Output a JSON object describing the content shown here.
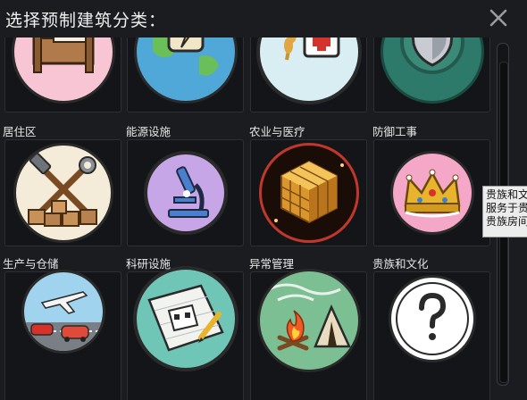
{
  "header": {
    "title": "选择预制建筑分类："
  },
  "categories": [
    {
      "label": "居住区",
      "icon": "bed-icon"
    },
    {
      "label": "能源设施",
      "icon": "energy-globe-icon"
    },
    {
      "label": "农业与医疗",
      "icon": "wheat-medkit-icon"
    },
    {
      "label": "防御工事",
      "icon": "shield-icon"
    },
    {
      "label": "生产与仓储",
      "icon": "tools-crates-icon"
    },
    {
      "label": "科研设施",
      "icon": "microscope-icon"
    },
    {
      "label": "异常管理",
      "icon": "golden-cube-icon"
    },
    {
      "label": "贵族和文化",
      "icon": "crown-icon"
    },
    {
      "label": "",
      "icon": "airplane-cars-icon"
    },
    {
      "label": "",
      "icon": "blueprint-icon"
    },
    {
      "label": "",
      "icon": "campfire-tent-icon"
    },
    {
      "label": "",
      "icon": "question-mark-icon"
    }
  ],
  "tooltip": {
    "lines": [
      "贵族和文",
      "服务于贵",
      "贵族房间"
    ]
  }
}
